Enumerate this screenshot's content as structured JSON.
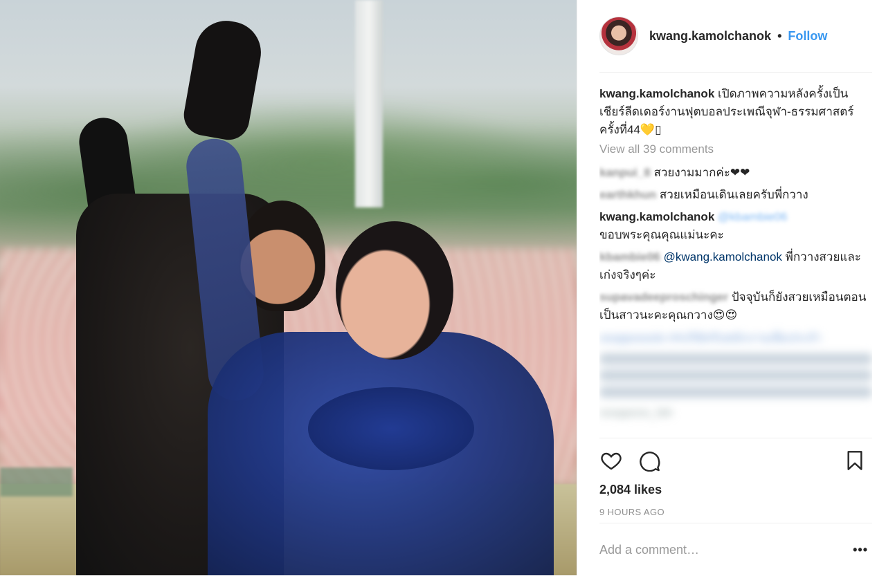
{
  "post": {
    "username": "kwang.kamolchanok",
    "separator": "•",
    "follow_label": "Follow",
    "caption_user": "kwang.kamolchanok",
    "caption_text": "เปิดภาพความหลังครั้งเป็นเชียร์ลีดเดอร์งานฟุตบอลประเพณีจุฬา-ธรรมศาสตร์ครั้งที่44💛▯",
    "view_all": "View all 39 comments",
    "comments": [
      {
        "user": "kanpui_8",
        "text": "สวยงามมากค่ะ❤❤"
      },
      {
        "user": "earthkhun",
        "text": "สวยเหมือนเดินเลยครับพี่กวาง"
      },
      {
        "user": "kwang.kamolchanok",
        "mention": "@kbambie06",
        "text": "ขอบพระคุณคุณแม่นะคะ"
      },
      {
        "user": "kbambie06",
        "mention": "@kwang.kamolchanok",
        "text": "พี่กวางสวยและเก่งจริงๆค่ะ"
      },
      {
        "user": "supavadeeproschinger",
        "text": "ปัจจุบันก็ยังสวยเหมือนตอนเป็นสาวนะคะคุณกวาง😍😍"
      }
    ],
    "hidden_comment": {
      "line1": "ssoppoosolo ##บริษัทรับพนักงานเพิ่มประจำ",
      "last_user": "ssoppoos_fah"
    },
    "likes": "2,084 likes",
    "time": "9 HOURS AGO",
    "add_comment_placeholder": "Add a comment…",
    "more": "•••"
  },
  "icons": [
    "heart-icon",
    "comment-icon",
    "bookmark-icon",
    "more-icon"
  ],
  "colors": {
    "link": "#3897f0",
    "text": "#262626",
    "muted": "#999999",
    "border": "#efefef"
  }
}
